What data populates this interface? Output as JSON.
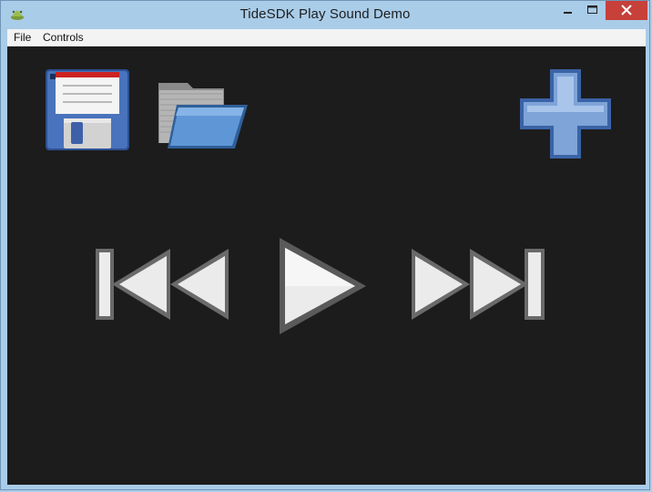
{
  "window": {
    "title": "TideSDK Play Sound Demo"
  },
  "menu": {
    "items": [
      "File",
      "Controls"
    ]
  },
  "toolbar": {
    "save_icon": "floppy-disk-save-icon",
    "open_icon": "open-folder-icon",
    "add_icon": "plus-add-icon"
  },
  "controls": {
    "previous_icon": "skip-previous-icon",
    "play_icon": "play-icon",
    "next_icon": "skip-next-icon"
  },
  "colors": {
    "titlebar": "#a9cce8",
    "close_button": "#c7403a",
    "content_background": "#1c1c1c",
    "menubar": "#f3f3f3"
  }
}
